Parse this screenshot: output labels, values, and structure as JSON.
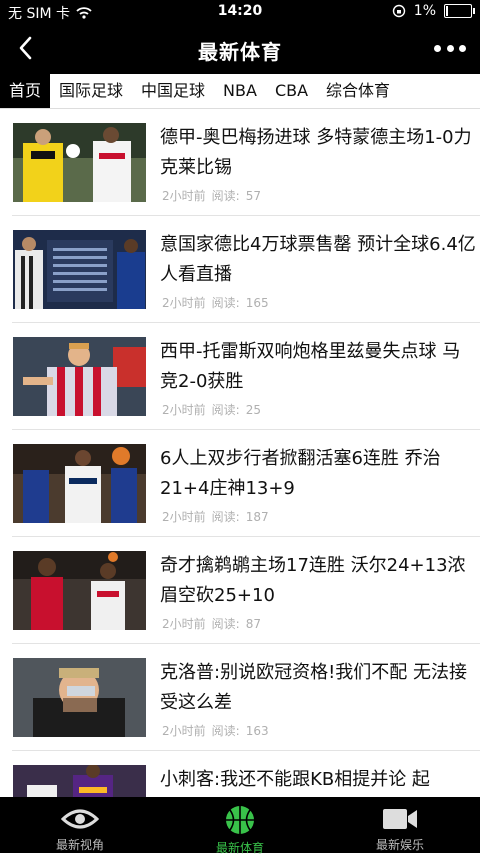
{
  "status_bar": {
    "carrier": "无 SIM 卡",
    "time": "14:20",
    "battery": "1%"
  },
  "nav": {
    "title": "最新体育",
    "back_icon": "chevron-left-icon",
    "more_icon": "more-dots-icon"
  },
  "tabs": [
    {
      "label": "首页",
      "active": true
    },
    {
      "label": "国际足球"
    },
    {
      "label": "中国足球"
    },
    {
      "label": "NBA"
    },
    {
      "label": "CBA"
    },
    {
      "label": "综合体育"
    }
  ],
  "articles": [
    {
      "title": "德甲-奥巴梅扬进球 多特蒙德主场1-0力克莱比锡",
      "time": "2小时前",
      "reads_label": "阅读:",
      "reads": "57"
    },
    {
      "title": "意国家德比4万球票售罄 预计全球6.4亿人看直播",
      "time": "2小时前",
      "reads_label": "阅读:",
      "reads": "165"
    },
    {
      "title": "西甲-托雷斯双响炮格里兹曼失点球 马竞2-0获胜",
      "time": "2小时前",
      "reads_label": "阅读:",
      "reads": "25"
    },
    {
      "title": "6人上双步行者掀翻活塞6连胜 乔治21+4庄神13+9",
      "time": "2小时前",
      "reads_label": "阅读:",
      "reads": "187"
    },
    {
      "title": "奇才擒鹈鹕主场17连胜 沃尔24+13浓眉空砍25+10",
      "time": "2小时前",
      "reads_label": "阅读:",
      "reads": "87"
    },
    {
      "title": "克洛普:别说欧冠资格!我们不配 无法接受这么差",
      "time": "2小时前",
      "reads_label": "阅读:",
      "reads": "163"
    },
    {
      "title": "小刺客:我还不能跟KB相提并论 起",
      "time": "",
      "reads_label": "",
      "reads": ""
    }
  ],
  "bottom_nav": [
    {
      "label": "最新视角",
      "icon": "eye-icon",
      "active": false
    },
    {
      "label": "最新体育",
      "icon": "basketball-icon",
      "active": true
    },
    {
      "label": "最新娱乐",
      "icon": "video-camera-icon",
      "active": false
    }
  ],
  "colors": {
    "bar_bg": "#000000",
    "active_green": "#39c24a",
    "meta_gray": "#b0b0b0"
  }
}
